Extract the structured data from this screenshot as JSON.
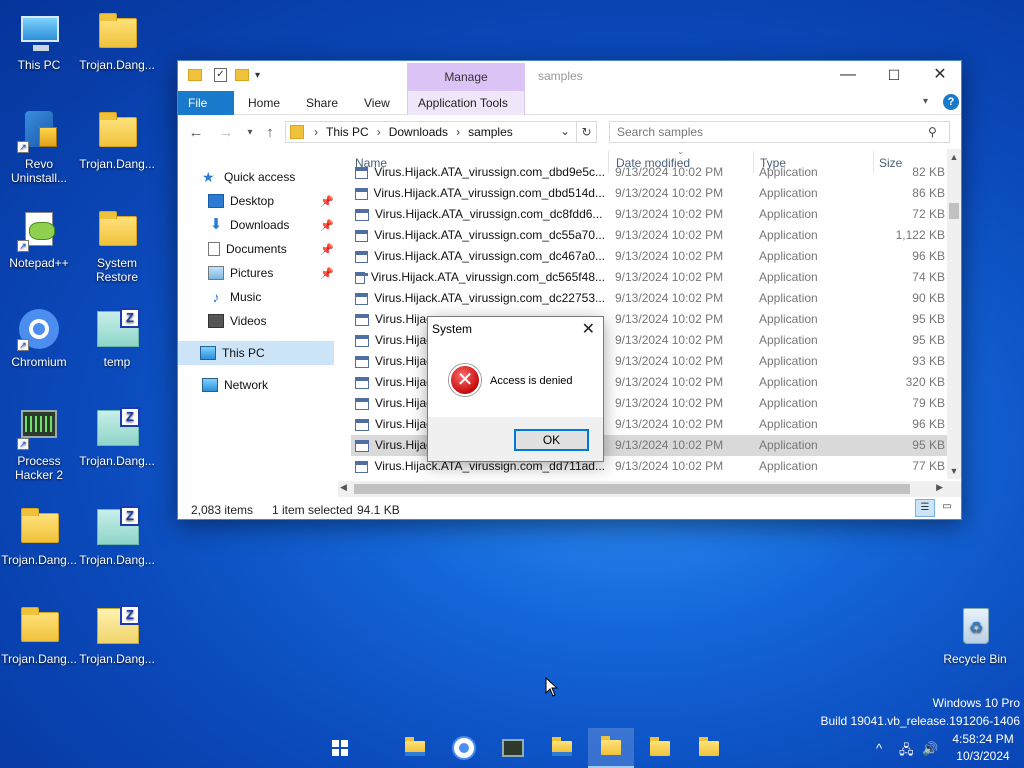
{
  "desktop": {
    "icons": [
      {
        "label": "This PC",
        "kind": "pc"
      },
      {
        "label": "Trojan.Dang...",
        "kind": "folder"
      },
      {
        "label": "Revo\nUninstall...",
        "kind": "app"
      },
      {
        "label": "Trojan.Dang...",
        "kind": "folder"
      },
      {
        "label": "Notepad++",
        "kind": "app"
      },
      {
        "label": "System\nRestore",
        "kind": "folder"
      },
      {
        "label": "Chromium",
        "kind": "app"
      },
      {
        "label": "temp",
        "kind": "zip"
      },
      {
        "label": "Process\nHacker 2",
        "kind": "app"
      },
      {
        "label": "Trojan.Dang...",
        "kind": "zip"
      },
      {
        "label": "Trojan.Dang...",
        "kind": "folder"
      },
      {
        "label": "Trojan.Dang...",
        "kind": "zip"
      },
      {
        "label": "Trojan.Dang...",
        "kind": "folder"
      },
      {
        "label": "Trojan.Dang...",
        "kind": "zip"
      },
      {
        "label": "Recycle Bin",
        "kind": "recycle"
      }
    ]
  },
  "explorer": {
    "title": "samples",
    "manage_tab": "Manage",
    "ribbon_tabs": {
      "file": "File",
      "home": "Home",
      "share": "Share",
      "view": "View",
      "app_tools": "Application Tools"
    },
    "breadcrumb": {
      "root": "This PC",
      "sep": "›",
      "folder1": "Downloads",
      "folder2": "samples"
    },
    "search_placeholder": "Search samples",
    "nav": {
      "quick_access": "Quick access",
      "desktop": "Desktop",
      "downloads": "Downloads",
      "documents": "Documents",
      "pictures": "Pictures",
      "music": "Music",
      "videos": "Videos",
      "this_pc": "This PC",
      "network": "Network"
    },
    "columns": {
      "name": "Name",
      "date": "Date modified",
      "type": "Type",
      "size": "Size"
    },
    "files": [
      {
        "name": "Virus.Hijack.ATA_virussign.com_dbd9e5c...",
        "date": "9/13/2024 10:02 PM",
        "type": "Application",
        "size": "82 KB"
      },
      {
        "name": "Virus.Hijack.ATA_virussign.com_dbd514d...",
        "date": "9/13/2024 10:02 PM",
        "type": "Application",
        "size": "86 KB"
      },
      {
        "name": "Virus.Hijack.ATA_virussign.com_dc8fdd6...",
        "date": "9/13/2024 10:02 PM",
        "type": "Application",
        "size": "72 KB"
      },
      {
        "name": "Virus.Hijack.ATA_virussign.com_dc55a70...",
        "date": "9/13/2024 10:02 PM",
        "type": "Application",
        "size": "1,122 KB"
      },
      {
        "name": "Virus.Hijack.ATA_virussign.com_dc467a0...",
        "date": "9/13/2024 10:02 PM",
        "type": "Application",
        "size": "96 KB"
      },
      {
        "name": "Virus.Hijack.ATA_virussign.com_dc565f48...",
        "date": "9/13/2024 10:02 PM",
        "type": "Application",
        "size": "74 KB"
      },
      {
        "name": "Virus.Hijack.ATA_virussign.com_dc22753...",
        "date": "9/13/2024 10:02 PM",
        "type": "Application",
        "size": "90 KB"
      },
      {
        "name": "Virus.Hijac",
        "date": "9/13/2024 10:02 PM",
        "type": "Application",
        "size": "95 KB"
      },
      {
        "name": "Virus.Hijac",
        "date": "9/13/2024 10:02 PM",
        "type": "Application",
        "size": "95 KB"
      },
      {
        "name": "Virus.Hijac",
        "date": "9/13/2024 10:02 PM",
        "type": "Application",
        "size": "93 KB"
      },
      {
        "name": "Virus.Hijac",
        "date": "9/13/2024 10:02 PM",
        "type": "Application",
        "size": "320 KB"
      },
      {
        "name": "Virus.Hijac",
        "date": "9/13/2024 10:02 PM",
        "type": "Application",
        "size": "79 KB"
      },
      {
        "name": "Virus.Hijac",
        "date": "9/13/2024 10:02 PM",
        "type": "Application",
        "size": "96 KB"
      },
      {
        "name": "Virus.Hijac",
        "date": "9/13/2024 10:02 PM",
        "type": "Application",
        "size": "95 KB",
        "selected": true
      },
      {
        "name": "Virus.Hijack.ATA_virussign.com_dd711ad...",
        "date": "9/13/2024 10:02 PM",
        "type": "Application",
        "size": "77 KB"
      }
    ],
    "status": {
      "count": "2,083 items",
      "selected": "1 item selected",
      "size": "94.1 KB"
    }
  },
  "dialog": {
    "title": "System",
    "message": "Access is denied",
    "ok_label": "OK"
  },
  "system": {
    "edition": "Windows 10 Pro",
    "build": "Build 19041.vb_release.191206-1406",
    "time": "4:58:24 PM",
    "date": "10/3/2024"
  },
  "colors": {
    "accent": "#0078d7",
    "file_tab": "#1979ca",
    "manage_tab": "#dcc3f5",
    "selection": "#cce4f7",
    "error": "#c40c0c"
  }
}
